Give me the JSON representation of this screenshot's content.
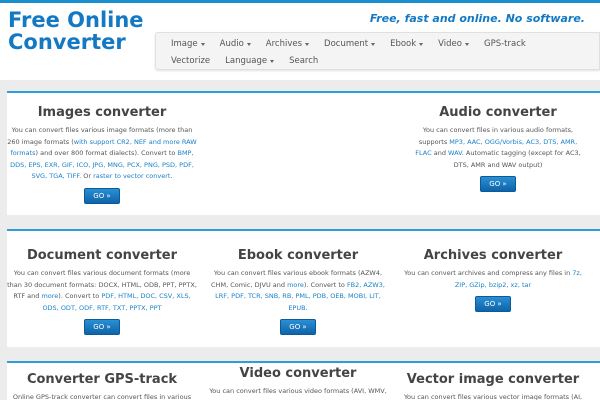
{
  "header": {
    "logo_line1": "Free Online",
    "logo_line2": "Converter",
    "tagline": "Free, fast and online. No software."
  },
  "nav": {
    "row1": [
      {
        "label": "Image",
        "dropdown": true
      },
      {
        "label": "Audio",
        "dropdown": true
      },
      {
        "label": "Archives",
        "dropdown": true
      },
      {
        "label": "Document",
        "dropdown": true
      },
      {
        "label": "Ebook",
        "dropdown": true
      },
      {
        "label": "Video",
        "dropdown": true
      },
      {
        "label": "GPS-track",
        "dropdown": false
      }
    ],
    "row2": [
      {
        "label": "Vectorize",
        "dropdown": false
      },
      {
        "label": "Language",
        "dropdown": true
      },
      {
        "label": "Search",
        "dropdown": false
      }
    ]
  },
  "cards": {
    "images": {
      "title": "Images converter",
      "t1": "You can convert files various image formats (more than 260 image formats (",
      "l1": "with support CR2, NEF and more RAW formats",
      "t2": ") and over 800 format dialects). Convert to ",
      "l2": "BMP, DDS, EPS, EXR, GIF, ICO, JPG, MNG, PCX, PNG, PSD, PDF, SVG, TGA, TIFF",
      "t3": ". Or ",
      "l3": "raster to vector convert",
      "t4": ".",
      "go": "GO »"
    },
    "audio": {
      "title": "Audio converter",
      "t1": "You can convert files in various audio formats, supports ",
      "l1": "MP3, AAC, OGG/Vorbis, AC3, DTS, AMR, FLAC",
      "t2": " and ",
      "l2": "WAV",
      "t3": ". Automatic tagging (except for AC3, DTS, AMR and WAV output)",
      "go": "GO »"
    },
    "document": {
      "title": "Document converter",
      "t1": "You can convert files various document formats (more than 30 document formats: DOCX, HTML, ODB, PPT, PPTX, RTF and ",
      "l1": "more",
      "t2": "). Convert to ",
      "l2": "PDF, HTML, DOC, CSV, XLS, ODS, ODT, ODF, RTF, TXT, PPTX, PPT",
      "go": "GO »"
    },
    "ebook": {
      "title": "Ebook converter",
      "t1": "You can convert files various ebook formats (AZW4, CHM, Comic, DJVU and ",
      "l1": "more",
      "t2": "). Convert to ",
      "l2": "FB2, AZW3, LRF, PDF, TCR, SNB, RB, PML, PDB, OEB, MOBI, LIT, EPUB",
      "t3": ".",
      "go": "GO »"
    },
    "archives": {
      "title": "Archives converter",
      "t1": "You can convert archives and compress any files in ",
      "l1": "7z, ZIP, GZip, bzip2, xz, tar",
      "go": "GO »"
    },
    "gps": {
      "title": "Converter GPS-track",
      "t1": "Online GPS-track converter can convert files in various GPS"
    },
    "video": {
      "title": "Video converter",
      "t1": "You can convert files various video formats (AVI, WMV,"
    },
    "vector": {
      "title": "Vector image converter",
      "t1": "You can convert files various vector image formats (AI,"
    }
  }
}
